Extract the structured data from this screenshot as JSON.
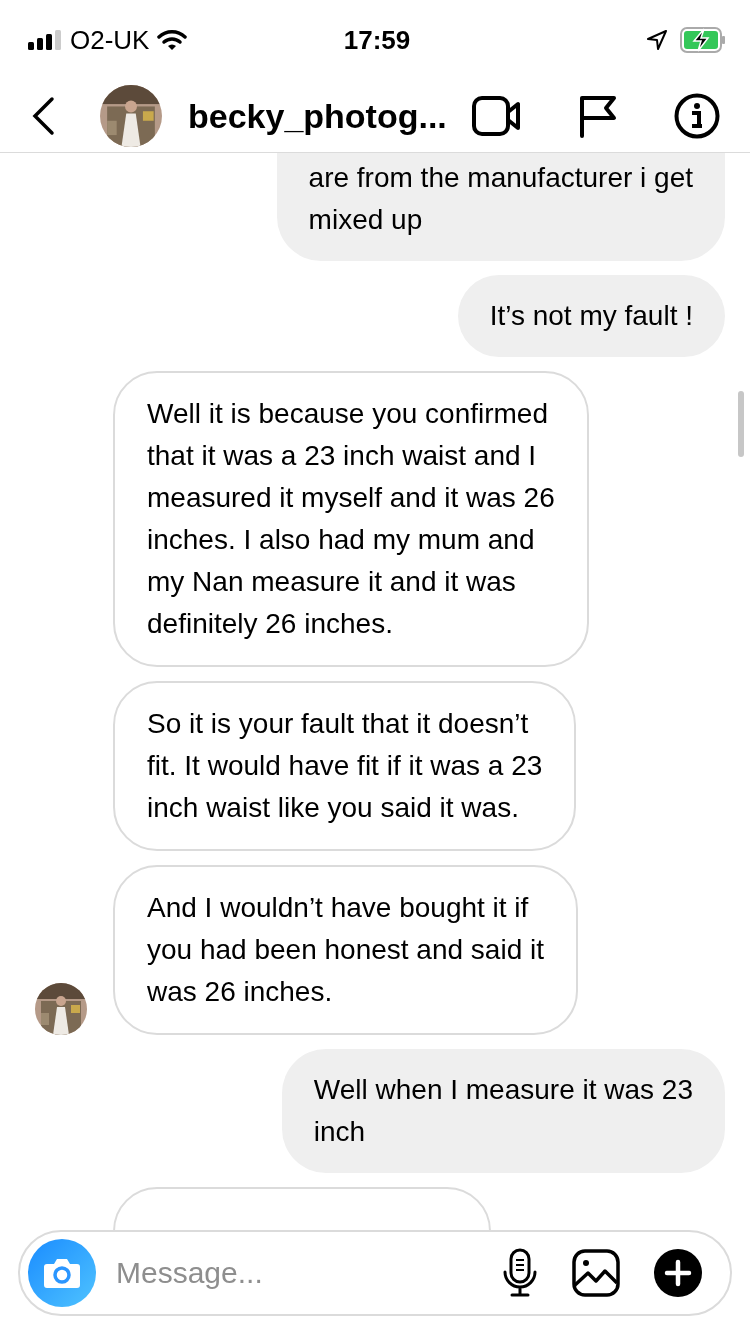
{
  "status_bar": {
    "carrier": "O2-UK",
    "time": "17:59"
  },
  "header": {
    "username": "becky_photog..."
  },
  "messages": [
    {
      "kind": "sent",
      "text": "are from the manufacturer i get\nmixed up"
    },
    {
      "kind": "sent",
      "text": "It’s not my fault !"
    },
    {
      "kind": "received",
      "text": "Well it is because you confirmed\nthat it was a 23 inch waist and I\nmeasured it myself and it was 26\ninches. I also had my mum and\nmy Nan measure it and it was\ndefinitely 26 inches."
    },
    {
      "kind": "received",
      "text": "So it is your fault that it doesn’t\nfit. It would have fit if it was a 23\ninch waist like you said it was."
    },
    {
      "kind": "received",
      "text": "And I wouldn’t have bought it if\nyou had been honest and said it\nwas 26 inches.",
      "avatar": true
    },
    {
      "kind": "sent",
      "text": "Well when I measure it was 23\ninch"
    },
    {
      "kind": "received"
    }
  ],
  "composer": {
    "placeholder": "Message..."
  }
}
